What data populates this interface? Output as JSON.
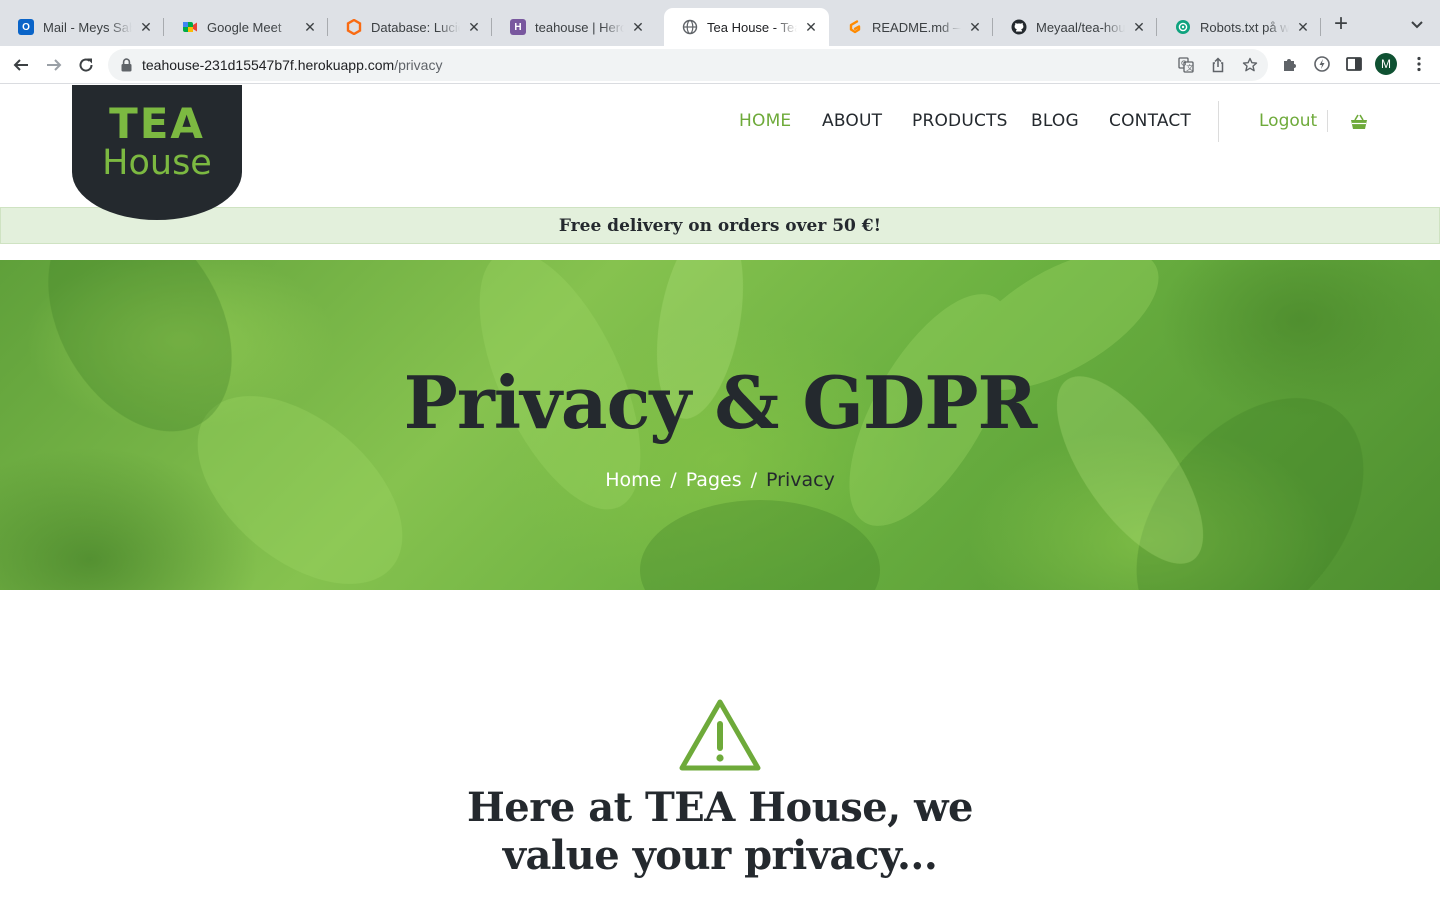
{
  "browser": {
    "tabs": [
      {
        "title": "Mail - Meys Sabah",
        "icon": "outlook-icon",
        "color": "#0a64c8",
        "active": false
      },
      {
        "title": "Google Meet",
        "icon": "google-meet-icon",
        "color": "#00ac47",
        "active": false
      },
      {
        "title": "Database: Lucidchart",
        "icon": "lucidchart-icon",
        "color": "#f96b13",
        "active": false
      },
      {
        "title": "teahouse | Heroku",
        "icon": "heroku-icon",
        "color": "#79589f",
        "active": false
      },
      {
        "title": "Tea House - Tea Shop",
        "icon": "globe-icon",
        "color": "#5f6368",
        "active": true
      },
      {
        "title": "README.md — teahouse",
        "icon": "gitpod-icon",
        "color": "#ff8a00",
        "active": false
      },
      {
        "title": "Meyaal/tea-house",
        "icon": "github-icon",
        "color": "#24292e",
        "active": false
      },
      {
        "title": "Robots.txt på webb",
        "icon": "openai-icon",
        "color": "#10a37f",
        "active": false
      }
    ],
    "url_host": "teahouse-231d15547b7f.herokuapp.com",
    "url_path": "/privacy",
    "profile_initial": "M"
  },
  "site": {
    "logo": {
      "line1": "TEA",
      "line2": "House"
    },
    "nav": {
      "home": "HOME",
      "about": "ABOUT",
      "products": "PRODUCTS",
      "blog": "BLOG",
      "contact": "CONTACT",
      "logout": "Logout"
    },
    "promo": "Free delivery on orders over 50 €!",
    "hero": {
      "title": "Privacy & GDPR",
      "breadcrumb": {
        "home": "Home",
        "pages": "Pages",
        "current": "Privacy",
        "separator": "/"
      }
    },
    "content": {
      "heading_line1": "Here at TEA House, we",
      "heading_line2": "value your privacy..."
    },
    "colors": {
      "accent": "#6eaa3a",
      "dark": "#24292e",
      "promo_bg": "#e3f0dc"
    }
  }
}
